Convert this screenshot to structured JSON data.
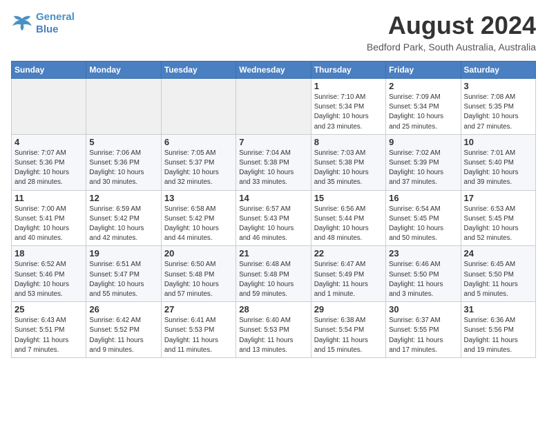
{
  "header": {
    "logo_line1": "General",
    "logo_line2": "Blue",
    "month": "August 2024",
    "location": "Bedford Park, South Australia, Australia"
  },
  "weekdays": [
    "Sunday",
    "Monday",
    "Tuesday",
    "Wednesday",
    "Thursday",
    "Friday",
    "Saturday"
  ],
  "weeks": [
    [
      {
        "day": "",
        "info": ""
      },
      {
        "day": "",
        "info": ""
      },
      {
        "day": "",
        "info": ""
      },
      {
        "day": "",
        "info": ""
      },
      {
        "day": "1",
        "info": "Sunrise: 7:10 AM\nSunset: 5:34 PM\nDaylight: 10 hours\nand 23 minutes."
      },
      {
        "day": "2",
        "info": "Sunrise: 7:09 AM\nSunset: 5:34 PM\nDaylight: 10 hours\nand 25 minutes."
      },
      {
        "day": "3",
        "info": "Sunrise: 7:08 AM\nSunset: 5:35 PM\nDaylight: 10 hours\nand 27 minutes."
      }
    ],
    [
      {
        "day": "4",
        "info": "Sunrise: 7:07 AM\nSunset: 5:36 PM\nDaylight: 10 hours\nand 28 minutes."
      },
      {
        "day": "5",
        "info": "Sunrise: 7:06 AM\nSunset: 5:36 PM\nDaylight: 10 hours\nand 30 minutes."
      },
      {
        "day": "6",
        "info": "Sunrise: 7:05 AM\nSunset: 5:37 PM\nDaylight: 10 hours\nand 32 minutes."
      },
      {
        "day": "7",
        "info": "Sunrise: 7:04 AM\nSunset: 5:38 PM\nDaylight: 10 hours\nand 33 minutes."
      },
      {
        "day": "8",
        "info": "Sunrise: 7:03 AM\nSunset: 5:38 PM\nDaylight: 10 hours\nand 35 minutes."
      },
      {
        "day": "9",
        "info": "Sunrise: 7:02 AM\nSunset: 5:39 PM\nDaylight: 10 hours\nand 37 minutes."
      },
      {
        "day": "10",
        "info": "Sunrise: 7:01 AM\nSunset: 5:40 PM\nDaylight: 10 hours\nand 39 minutes."
      }
    ],
    [
      {
        "day": "11",
        "info": "Sunrise: 7:00 AM\nSunset: 5:41 PM\nDaylight: 10 hours\nand 40 minutes."
      },
      {
        "day": "12",
        "info": "Sunrise: 6:59 AM\nSunset: 5:42 PM\nDaylight: 10 hours\nand 42 minutes."
      },
      {
        "day": "13",
        "info": "Sunrise: 6:58 AM\nSunset: 5:42 PM\nDaylight: 10 hours\nand 44 minutes."
      },
      {
        "day": "14",
        "info": "Sunrise: 6:57 AM\nSunset: 5:43 PM\nDaylight: 10 hours\nand 46 minutes."
      },
      {
        "day": "15",
        "info": "Sunrise: 6:56 AM\nSunset: 5:44 PM\nDaylight: 10 hours\nand 48 minutes."
      },
      {
        "day": "16",
        "info": "Sunrise: 6:54 AM\nSunset: 5:45 PM\nDaylight: 10 hours\nand 50 minutes."
      },
      {
        "day": "17",
        "info": "Sunrise: 6:53 AM\nSunset: 5:45 PM\nDaylight: 10 hours\nand 52 minutes."
      }
    ],
    [
      {
        "day": "18",
        "info": "Sunrise: 6:52 AM\nSunset: 5:46 PM\nDaylight: 10 hours\nand 53 minutes."
      },
      {
        "day": "19",
        "info": "Sunrise: 6:51 AM\nSunset: 5:47 PM\nDaylight: 10 hours\nand 55 minutes."
      },
      {
        "day": "20",
        "info": "Sunrise: 6:50 AM\nSunset: 5:48 PM\nDaylight: 10 hours\nand 57 minutes."
      },
      {
        "day": "21",
        "info": "Sunrise: 6:48 AM\nSunset: 5:48 PM\nDaylight: 10 hours\nand 59 minutes."
      },
      {
        "day": "22",
        "info": "Sunrise: 6:47 AM\nSunset: 5:49 PM\nDaylight: 11 hours\nand 1 minute."
      },
      {
        "day": "23",
        "info": "Sunrise: 6:46 AM\nSunset: 5:50 PM\nDaylight: 11 hours\nand 3 minutes."
      },
      {
        "day": "24",
        "info": "Sunrise: 6:45 AM\nSunset: 5:50 PM\nDaylight: 11 hours\nand 5 minutes."
      }
    ],
    [
      {
        "day": "25",
        "info": "Sunrise: 6:43 AM\nSunset: 5:51 PM\nDaylight: 11 hours\nand 7 minutes."
      },
      {
        "day": "26",
        "info": "Sunrise: 6:42 AM\nSunset: 5:52 PM\nDaylight: 11 hours\nand 9 minutes."
      },
      {
        "day": "27",
        "info": "Sunrise: 6:41 AM\nSunset: 5:53 PM\nDaylight: 11 hours\nand 11 minutes."
      },
      {
        "day": "28",
        "info": "Sunrise: 6:40 AM\nSunset: 5:53 PM\nDaylight: 11 hours\nand 13 minutes."
      },
      {
        "day": "29",
        "info": "Sunrise: 6:38 AM\nSunset: 5:54 PM\nDaylight: 11 hours\nand 15 minutes."
      },
      {
        "day": "30",
        "info": "Sunrise: 6:37 AM\nSunset: 5:55 PM\nDaylight: 11 hours\nand 17 minutes."
      },
      {
        "day": "31",
        "info": "Sunrise: 6:36 AM\nSunset: 5:56 PM\nDaylight: 11 hours\nand 19 minutes."
      }
    ]
  ]
}
